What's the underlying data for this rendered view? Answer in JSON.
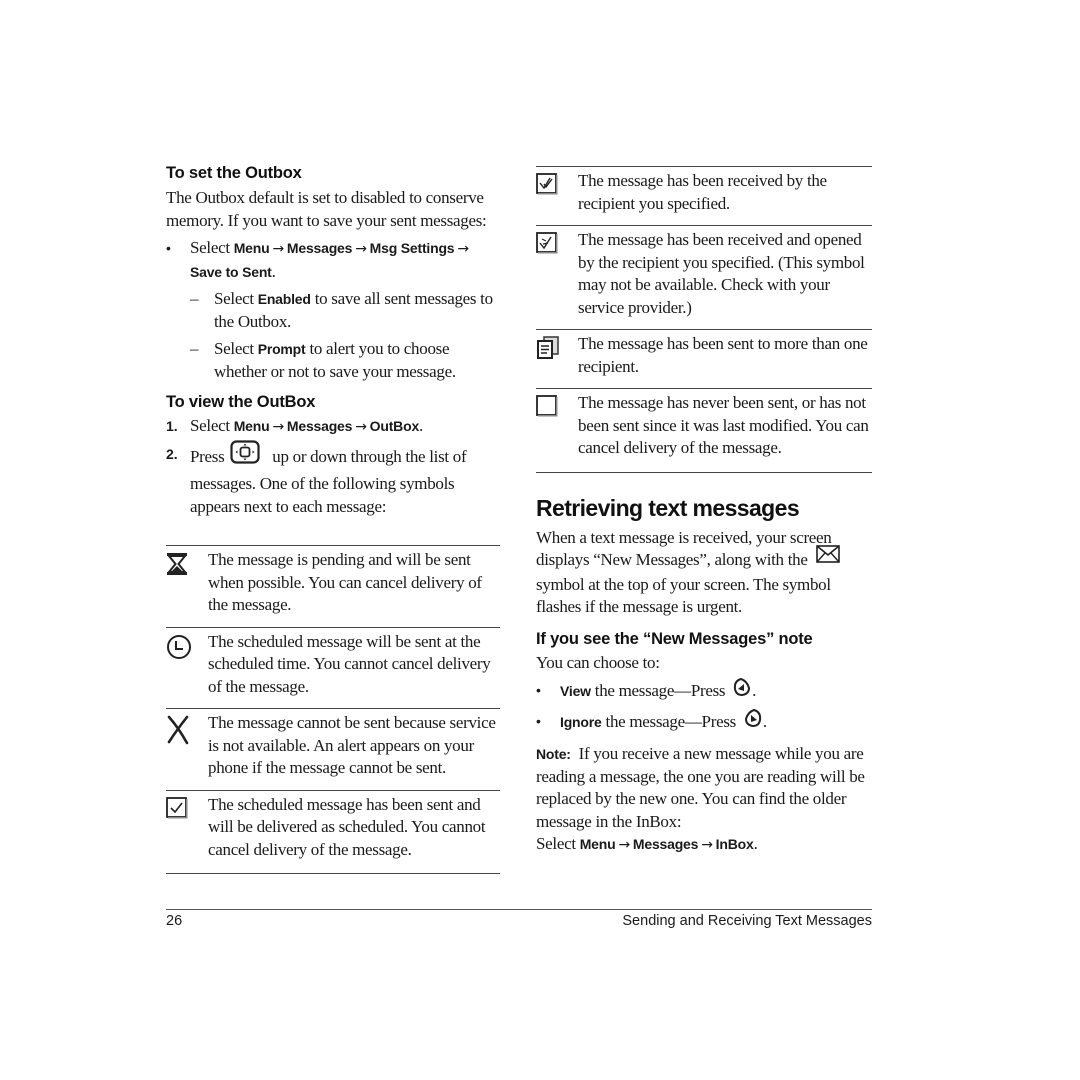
{
  "left": {
    "set_outbox": {
      "heading": "To set the Outbox",
      "intro": "The Outbox default is set to disabled to conserve memory. If you want to save your sent messages:",
      "bullet": {
        "prefix": "Select ",
        "path": [
          "Menu",
          "Messages",
          "Msg Settings",
          "Save to Sent"
        ],
        "suffix": "."
      },
      "sub_items": [
        {
          "prefix": "Select ",
          "keyword": "Enabled",
          "text": " to save all sent messages to the Outbox."
        },
        {
          "prefix": "Select ",
          "keyword": "Prompt",
          "text": " to alert you to choose whether or not to save your message."
        }
      ]
    },
    "view_outbox": {
      "heading": "To view the OutBox",
      "steps": [
        {
          "num": "1.",
          "prefix": "Select ",
          "path": [
            "Menu",
            "Messages",
            "OutBox"
          ],
          "suffix": "."
        },
        {
          "num": "2.",
          "prefix": "Press ",
          "icon": "navigation-key-icon",
          "text": " up or down through the list of messages. One of the following symbols appears next to each message:"
        }
      ]
    },
    "symbols": [
      {
        "icon": "hourglass-icon",
        "text": "The message is pending and will be sent when possible. You can cancel delivery of the message."
      },
      {
        "icon": "clock-icon",
        "text": "The scheduled message will be sent at the scheduled time. You cannot cancel delivery of the message."
      },
      {
        "icon": "x-mark-icon",
        "text": "The message cannot be sent because service is not available. An alert appears on your phone if the message cannot be sent."
      },
      {
        "icon": "checkbox-checked-icon",
        "text": "The scheduled message has been sent and will be delivered as scheduled. You cannot cancel delivery of the message."
      }
    ]
  },
  "right": {
    "symbols": [
      {
        "icon": "received-check-icon",
        "text": "The message has been received by the recipient you specified."
      },
      {
        "icon": "opened-check-icon",
        "text": "The message has been received and opened by the recipient you specified. (This symbol may not be available. Check with your service provider.)"
      },
      {
        "icon": "multiple-recipients-icon",
        "text": "The message has been sent to more than one recipient."
      },
      {
        "icon": "empty-box-icon",
        "text": "The message has never been sent, or has not been sent since it was last modified. You can cancel delivery of the message."
      }
    ],
    "retrieving": {
      "title": "Retrieving text messages",
      "intro_before_icon": "When a text message is received, your screen displays “New Messages”, along with the ",
      "intro_icon": "envelope-icon",
      "intro_after_icon": " symbol at the top of your screen. The symbol flashes if the message is urgent.",
      "subheading": "If you see the “New Messages” note",
      "choose": "You can choose to:",
      "options": [
        {
          "keyword": "View",
          "text": " the message—Press ",
          "icon": "left-softkey-icon",
          "suffix": "."
        },
        {
          "keyword": "Ignore",
          "text": " the message—Press ",
          "icon": "right-softkey-icon",
          "suffix": "."
        }
      ],
      "note_label": "Note:",
      "note_text": "  If you receive a new message while you are reading a message, the one you are reading will be replaced by the new one. You can find the older message in the InBox:",
      "final": {
        "prefix": "Select ",
        "path": [
          "Menu",
          "Messages",
          "InBox"
        ],
        "suffix": "."
      }
    }
  },
  "footer": {
    "page_number": "26",
    "chapter_title": "Sending and Receiving Text Messages"
  },
  "glyphs": {
    "arrow": "→",
    "bullet": "•",
    "dash": "–"
  }
}
